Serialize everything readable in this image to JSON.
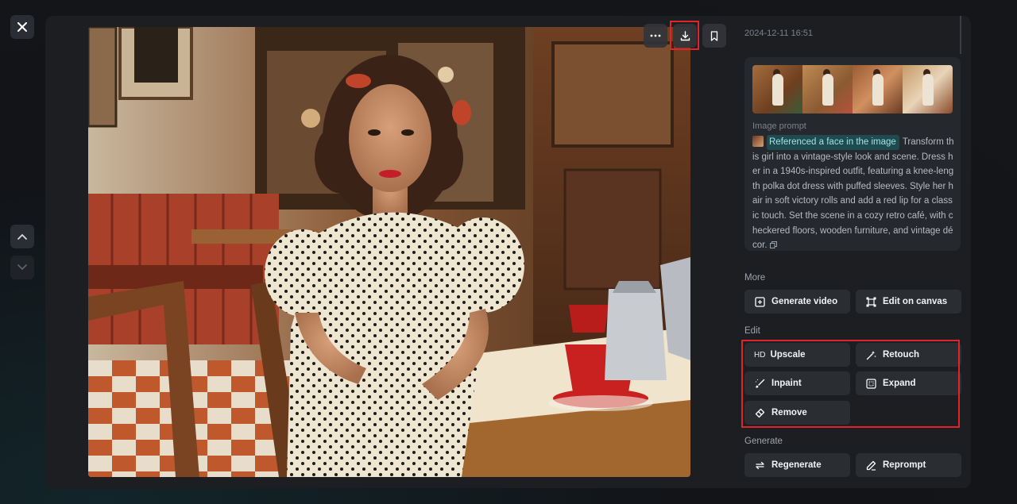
{
  "window": {
    "close_icon": "close-icon",
    "nav_up_icon": "chevron-up-icon",
    "nav_down_icon": "chevron-down-icon"
  },
  "image_toolbar": {
    "more_icon": "ellipsis-icon",
    "download_icon": "download-icon",
    "bookmark_icon": "bookmark-icon"
  },
  "details": {
    "timestamp": "2024-12-11 16:51",
    "prompt_label": "Image prompt",
    "reference_chip": "Referenced a face in the image",
    "prompt_text": "Transform this girl into a vintage-style look and scene. Dress her in a 1940s-inspired outfit, featuring a knee-length polka dot dress with puffed sleeves. Style her hair in soft victory rolls and add a red lip for a classic touch. Set the scene in a cozy retro café, with checkered floors, wooden furniture, and vintage décor."
  },
  "more": {
    "label": "More",
    "generate_video": "Generate video",
    "edit_on_canvas": "Edit on canvas"
  },
  "edit": {
    "label": "Edit",
    "upscale_prefix": "HD",
    "upscale": "Upscale",
    "retouch": "Retouch",
    "inpaint": "Inpaint",
    "expand": "Expand",
    "remove": "Remove"
  },
  "generate": {
    "label": "Generate",
    "regenerate": "Regenerate",
    "reprompt": "Reprompt"
  },
  "colors": {
    "highlight": "#e0242b",
    "panel": "#1c1e22",
    "button": "#2a2d32",
    "chip_bg": "#1f4a4f"
  }
}
